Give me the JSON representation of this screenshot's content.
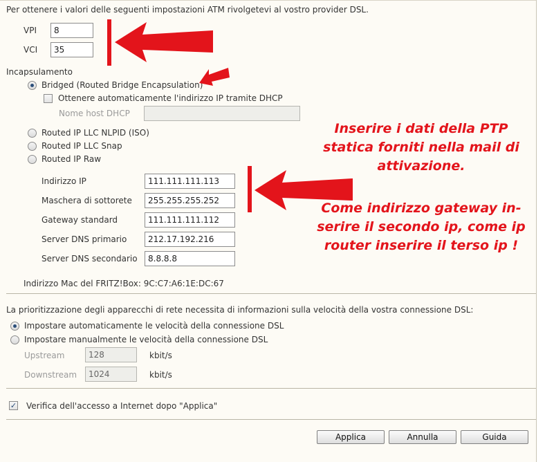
{
  "intro": "Per ottenere i valori delle seguenti impostazioni ATM rivolgetevi al vostro provider DSL.",
  "atm": {
    "vpi_label": "VPI",
    "vpi_value": "8",
    "vci_label": "VCI",
    "vci_value": "35"
  },
  "encapsulation": {
    "heading": "Incapsulamento",
    "bridged": "Bridged (Routed Bridge Encapsulation)",
    "dhcp_checkbox": "Ottenere automaticamente l'indirizzo IP tramite DHCP",
    "dhcp_host_label": "Nome host DHCP",
    "dhcp_host_value": "",
    "routed_nlpid": "Routed IP LLC NLPID (ISO)",
    "routed_snap": "Routed IP LLC Snap",
    "routed_raw": "Routed IP Raw"
  },
  "ip": {
    "address_label": "Indirizzo IP",
    "address_value": "111.111.111.113",
    "mask_label": "Maschera di sottorete",
    "mask_value": "255.255.255.252",
    "gateway_label": "Gateway standard",
    "gateway_value": "111.111.111.112",
    "dns1_label": "Server DNS primario",
    "dns1_value": "212.17.192.216",
    "dns2_label": "Server DNS secondario",
    "dns2_value": "8.8.8.8"
  },
  "mac": "Indirizzo Mac del FRITZ!Box: 9C:C7:A6:1E:DC:67",
  "speed": {
    "intro": "La prioritizzazione degli apparecchi di rete necessita di informazioni sulla velocità della vostra connessione DSL:",
    "auto": "Impostare automaticamente le velocità della connessione DSL",
    "manual": "Impostare manualmente le velocità della connessione DSL",
    "upstream_label": "Upstream",
    "upstream_value": "128",
    "downstream_label": "Downstream",
    "downstream_value": "1024",
    "unit": "kbit/s"
  },
  "verify": "Verifica dell'accesso a Internet dopo \"Applica\"",
  "buttons": {
    "apply": "Applica",
    "cancel": "Annulla",
    "help": "Guida"
  },
  "annotation": {
    "line1": "Inserire i dati della PTP",
    "line2": "statica forniti nella mail di",
    "line3": "attivazione.",
    "line4": "Come indirizzo gateway in-",
    "line5": "serire il secondo ip, come ip",
    "line6": "router inserire il terso ip !"
  },
  "colors": {
    "annotation_red": "#e3141b",
    "panel_bg": "#fdfbf5"
  }
}
